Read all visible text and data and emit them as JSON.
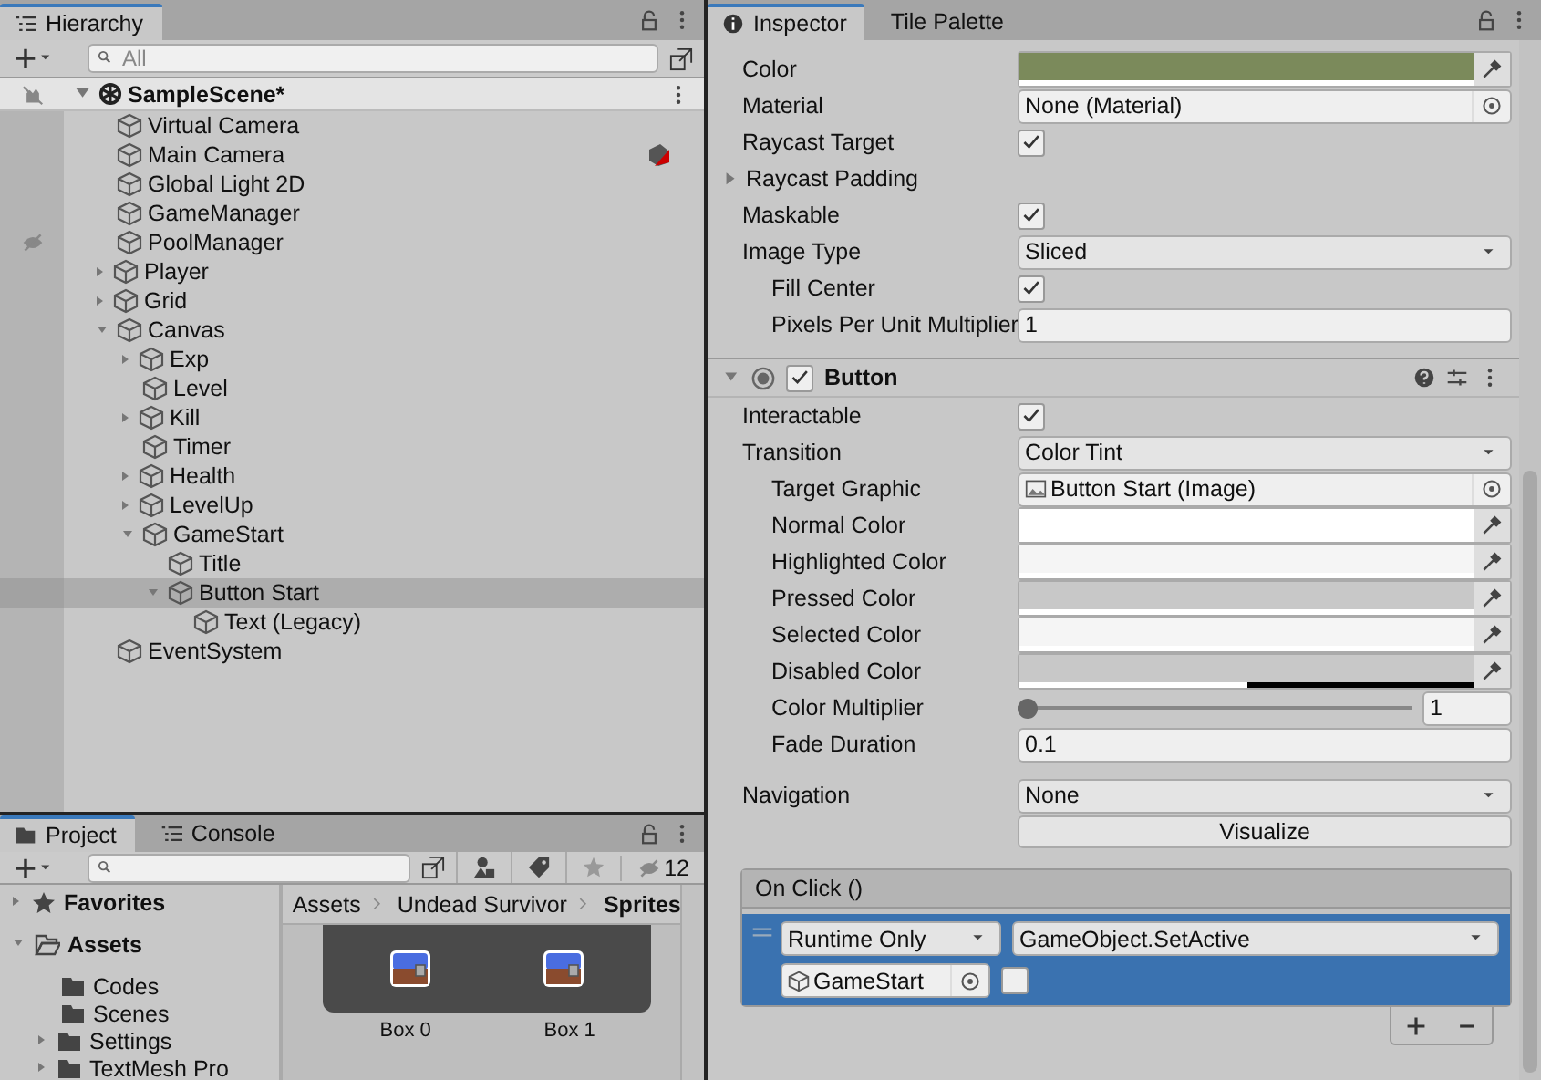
{
  "hierarchy": {
    "tab": "Hierarchy",
    "search_placeholder": "All",
    "scene": {
      "name": "SampleScene*",
      "expanded": true
    },
    "items": [
      {
        "name": "Virtual Camera",
        "expandable": false,
        "expanded": false,
        "selected": false,
        "hidden": false,
        "gizmo": false
      },
      {
        "name": "Main Camera",
        "expandable": false,
        "expanded": false,
        "selected": false,
        "hidden": false,
        "gizmo": true
      },
      {
        "name": "Global Light 2D",
        "expandable": false,
        "expanded": false,
        "selected": false,
        "hidden": false,
        "gizmo": false
      },
      {
        "name": "GameManager",
        "expandable": false,
        "expanded": false,
        "selected": false,
        "hidden": false,
        "gizmo": false
      },
      {
        "name": "PoolManager",
        "expandable": false,
        "expanded": false,
        "selected": false,
        "hidden": true,
        "gizmo": false
      },
      {
        "name": "Player",
        "expandable": true,
        "expanded": false,
        "selected": false,
        "hidden": false,
        "gizmo": false
      },
      {
        "name": "Grid",
        "expandable": true,
        "expanded": false,
        "selected": false,
        "hidden": false,
        "gizmo": false
      },
      {
        "name": "Canvas",
        "expandable": true,
        "expanded": true,
        "selected": false,
        "hidden": false,
        "gizmo": false,
        "children": [
          {
            "name": "Exp",
            "expandable": true,
            "expanded": false,
            "selected": false,
            "hidden": false,
            "gizmo": false
          },
          {
            "name": "Level",
            "expandable": false,
            "expanded": false,
            "selected": false,
            "hidden": false,
            "gizmo": false
          },
          {
            "name": "Kill",
            "expandable": true,
            "expanded": false,
            "selected": false,
            "hidden": false,
            "gizmo": false
          },
          {
            "name": "Timer",
            "expandable": false,
            "expanded": false,
            "selected": false,
            "hidden": false,
            "gizmo": false
          },
          {
            "name": "Health",
            "expandable": true,
            "expanded": false,
            "selected": false,
            "hidden": false,
            "gizmo": false
          },
          {
            "name": "LevelUp",
            "expandable": true,
            "expanded": false,
            "selected": false,
            "hidden": false,
            "gizmo": false
          },
          {
            "name": "GameStart",
            "expandable": true,
            "expanded": true,
            "selected": false,
            "hidden": false,
            "gizmo": false,
            "children": [
              {
                "name": "Title",
                "expandable": false,
                "expanded": false,
                "selected": false,
                "hidden": false,
                "gizmo": false
              },
              {
                "name": "Button Start",
                "expandable": true,
                "expanded": true,
                "selected": true,
                "hidden": false,
                "gizmo": false,
                "children": [
                  {
                    "name": "Text (Legacy)",
                    "expandable": false,
                    "expanded": false,
                    "selected": false,
                    "hidden": false,
                    "gizmo": false
                  }
                ]
              }
            ]
          }
        ]
      },
      {
        "name": "EventSystem",
        "expandable": false,
        "expanded": false,
        "selected": false,
        "hidden": false,
        "gizmo": false
      }
    ]
  },
  "project": {
    "tabs": [
      {
        "label": "Project",
        "selected": true
      },
      {
        "label": "Console",
        "selected": false
      }
    ],
    "hidden_count": "12",
    "folders": [
      {
        "label": "Favorites",
        "kind": "favorites",
        "expandable": true,
        "expanded": false
      },
      {
        "label": "Assets",
        "kind": "folder",
        "expandable": true,
        "expanded": true,
        "children": [
          {
            "label": "Codes",
            "kind": "folder",
            "expandable": false,
            "expanded": false
          },
          {
            "label": "Scenes",
            "kind": "folder",
            "expandable": false,
            "expanded": false
          },
          {
            "label": "Settings",
            "kind": "folder",
            "expandable": true,
            "expanded": false
          },
          {
            "label": "TextMesh Pro",
            "kind": "folder",
            "expandable": true,
            "expanded": false
          }
        ]
      }
    ],
    "breadcrumb": [
      {
        "label": "Assets",
        "current": false
      },
      {
        "label": "Undead Survivor",
        "current": false
      },
      {
        "label": "Sprites",
        "current": true
      }
    ],
    "assets": [
      {
        "label": "Box 0"
      },
      {
        "label": "Box 1"
      }
    ]
  },
  "inspector": {
    "tabs": [
      {
        "label": "Inspector",
        "selected": true
      },
      {
        "label": "Tile Palette",
        "selected": false
      }
    ],
    "image_fields": [
      {
        "kind": "color",
        "label": "Color",
        "color": "#7b8a5b",
        "level": 1
      },
      {
        "kind": "object",
        "label": "Material",
        "value": "None (Material)"
      },
      {
        "kind": "checkbox",
        "label": "Raycast Target",
        "checked": true
      },
      {
        "kind": "foldout",
        "label": "Raycast Padding",
        "expanded": false
      },
      {
        "kind": "checkbox",
        "label": "Maskable",
        "checked": true
      },
      {
        "kind": "dropdown",
        "label": "Image Type",
        "value": "Sliced",
        "children": [
          {
            "kind": "checkbox",
            "label": "Fill Center",
            "checked": true
          },
          {
            "kind": "text",
            "label": "Pixels Per Unit Multiplier",
            "value": "1"
          }
        ]
      }
    ],
    "component": {
      "title": "Button",
      "expanded": true,
      "enabled": true,
      "fields": [
        {
          "kind": "checkbox",
          "label": "Interactable",
          "checked": true
        },
        {
          "kind": "dropdown",
          "label": "Transition",
          "value": "Color Tint",
          "children": [
            {
              "kind": "image_ref",
              "label": "Target Graphic",
              "value": "Button Start (Image)"
            },
            {
              "kind": "color",
              "label": "Normal Color",
              "color": "#ffffff",
              "level": 1
            },
            {
              "kind": "color",
              "label": "Highlighted Color",
              "color": "#f5f5f5",
              "level": 1
            },
            {
              "kind": "color",
              "label": "Pressed Color",
              "color": "#c8c8c8",
              "level": 1
            },
            {
              "kind": "color",
              "label": "Selected Color",
              "color": "#f5f5f5",
              "level": 1
            },
            {
              "kind": "color",
              "label": "Disabled Color",
              "color": "#c8c8c8",
              "level": 0.5
            },
            {
              "kind": "slider",
              "label": "Color Multiplier",
              "level": 0,
              "value": "1"
            },
            {
              "kind": "text",
              "label": "Fade Duration",
              "value": "0.1"
            }
          ]
        },
        {
          "kind": "dropdown",
          "label": "Navigation",
          "value": "None"
        },
        {
          "kind": "button",
          "label": "Visualize"
        }
      ],
      "on_click": {
        "title": "On Click ()",
        "entries": [
          {
            "runtime": "Runtime Only",
            "function": "GameObject.SetActive",
            "target": "GameStart",
            "value": false,
            "selected": true
          }
        ]
      }
    }
  }
}
